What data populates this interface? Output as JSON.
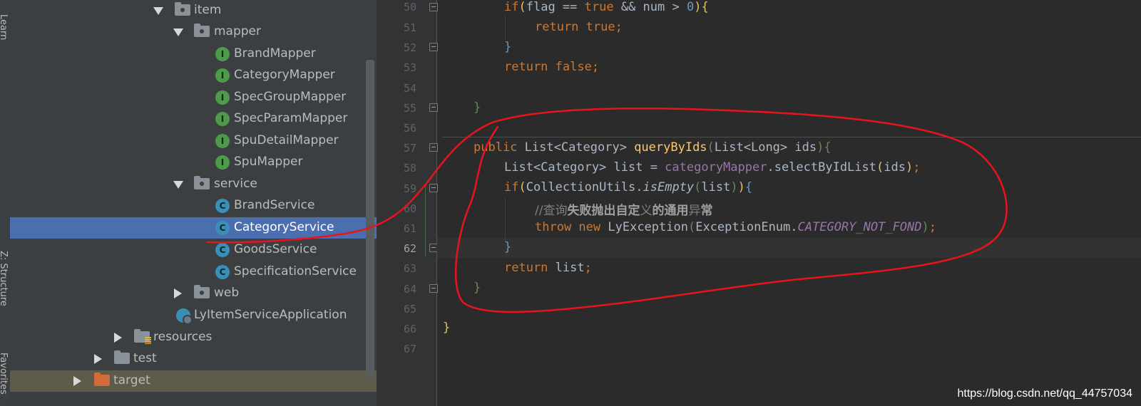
{
  "tool_strip": {
    "tabs": [
      "Learn",
      "Z: Structure",
      "Favorites"
    ]
  },
  "project_tree": {
    "nodes": [
      {
        "label": "item",
        "icon": "package-folder-icon",
        "expander": "expanded"
      },
      {
        "label": "mapper",
        "icon": "package-folder-icon",
        "expander": "expanded"
      },
      {
        "label": "BrandMapper",
        "icon": "interface-icon",
        "badge": "I"
      },
      {
        "label": "CategoryMapper",
        "icon": "interface-icon",
        "badge": "I"
      },
      {
        "label": "SpecGroupMapper",
        "icon": "interface-icon",
        "badge": "I"
      },
      {
        "label": "SpecParamMapper",
        "icon": "interface-icon",
        "badge": "I"
      },
      {
        "label": "SpuDetailMapper",
        "icon": "interface-icon",
        "badge": "I"
      },
      {
        "label": "SpuMapper",
        "icon": "interface-icon",
        "badge": "I"
      },
      {
        "label": "service",
        "icon": "package-folder-icon",
        "expander": "expanded"
      },
      {
        "label": "BrandService",
        "icon": "class-icon",
        "badge": "C"
      },
      {
        "label": "CategoryService",
        "icon": "class-icon",
        "badge": "C",
        "selected": true
      },
      {
        "label": "GoodsService",
        "icon": "class-icon",
        "badge": "C"
      },
      {
        "label": "SpecificationService",
        "icon": "class-icon",
        "badge": "C"
      },
      {
        "label": "web",
        "icon": "package-folder-icon",
        "expander": "collapsed"
      },
      {
        "label": "LyItemServiceApplication",
        "icon": "spring-app-icon"
      },
      {
        "label": "resources",
        "icon": "resources-folder-icon",
        "expander": "collapsed"
      },
      {
        "label": "test",
        "icon": "folder-icon",
        "expander": "collapsed"
      },
      {
        "label": "target",
        "icon": "excluded-folder-icon",
        "expander": "collapsed"
      }
    ]
  },
  "editor": {
    "line_numbers": [
      "50",
      "51",
      "52",
      "53",
      "54",
      "55",
      "56",
      "57",
      "58",
      "59",
      "60",
      "61",
      "62",
      "63",
      "64",
      "65",
      "66",
      "67"
    ],
    "current_line": "62",
    "lines": [
      "        if(flag == true && num > 0){",
      "            return true;",
      "        }",
      "        return false;",
      "",
      "    }",
      "",
      "    public List<Category> queryByIds(List<Long> ids){",
      "        List<Category> list = categoryMapper.selectByIdList(ids);",
      "        if(CollectionUtils.isEmpty(list)){",
      "            //查询失败抛出自定义的通用异常",
      "            throw new LyException(ExceptionEnum.CATEGORY_NOT_FOND);",
      "        }",
      "        return list;",
      "    }",
      "",
      "}",
      ""
    ],
    "tokens": {
      "l50": [
        "if",
        "(",
        "flag ",
        "== ",
        "true ",
        "&& ",
        "num ",
        "> ",
        "0",
        ")",
        "{"
      ],
      "l51": [
        "return ",
        "true",
        ";"
      ],
      "l52": [
        "}"
      ],
      "l53": [
        "return ",
        "false",
        ";"
      ],
      "l55": [
        "}"
      ],
      "l57": [
        "public ",
        "List<Category> ",
        "queryByIds",
        "(",
        "List<Long> ids",
        ")",
        "{"
      ],
      "l58": [
        "List<Category> list = ",
        "categoryMapper",
        ".selectByIdList",
        "(",
        "ids",
        ")",
        ";"
      ],
      "l59": [
        "if",
        "(",
        "CollectionUtils.",
        "isEmpty",
        "(",
        "list",
        ")",
        ")",
        "{"
      ],
      "l60": [
        "//查询",
        "失败抛出自定",
        "义",
        "的通用",
        "异",
        "常"
      ],
      "l61": [
        "throw ",
        "new ",
        "LyException",
        "(",
        "ExceptionEnum.",
        "CATEGORY_NOT_FOND",
        ")",
        ";"
      ],
      "l62": [
        "}"
      ],
      "l63": [
        "return ",
        "list",
        ";"
      ],
      "l64": [
        "}"
      ],
      "l66": [
        "}"
      ]
    }
  },
  "watermark": "https://blog.csdn.net/qq_44757034",
  "annotation_color": "#e8141c"
}
